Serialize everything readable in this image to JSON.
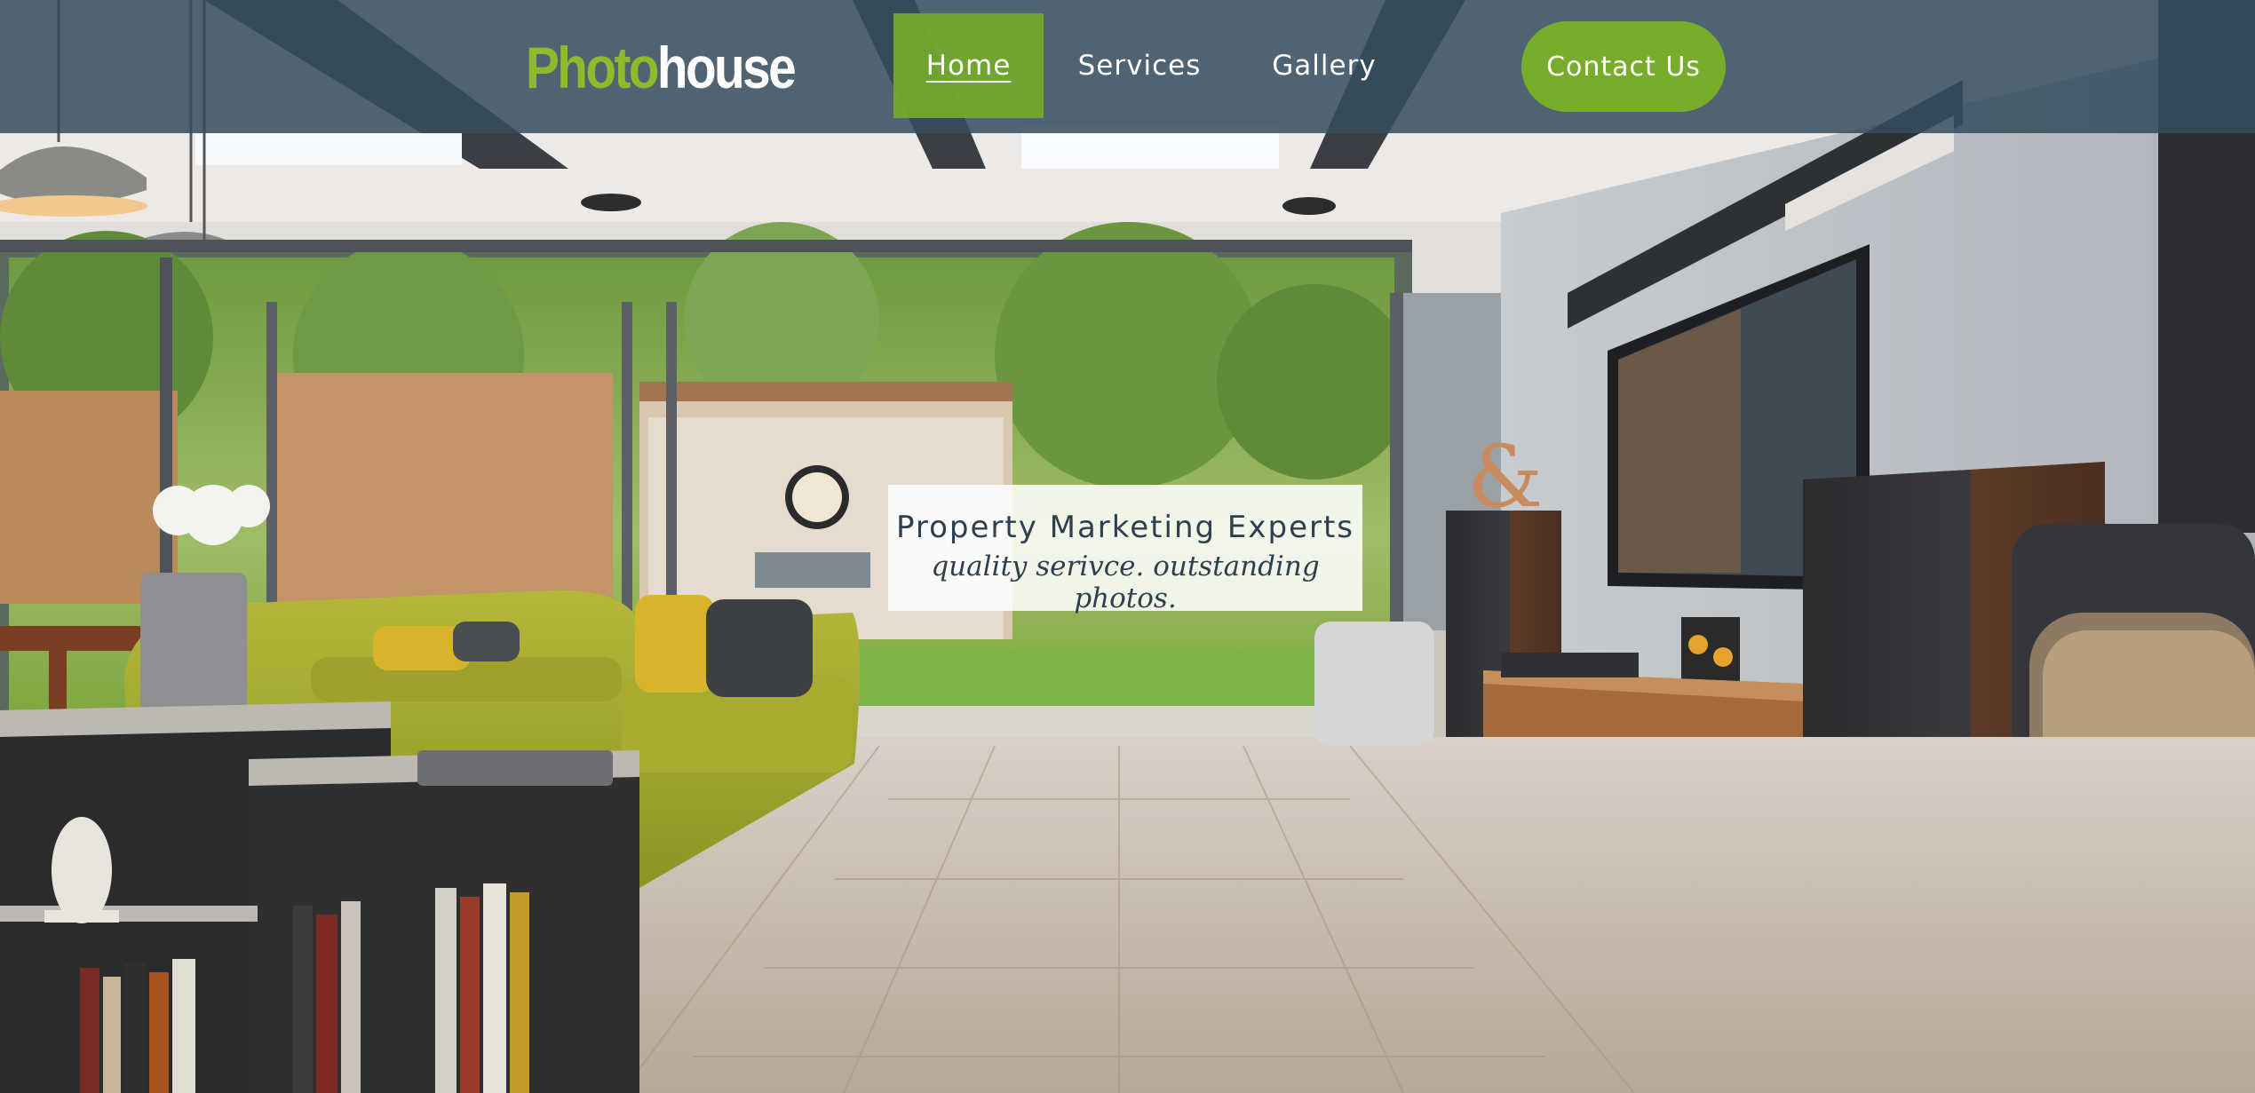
{
  "header": {
    "logo_part1": "Photo",
    "logo_part2": "house",
    "nav": [
      {
        "label": "Home",
        "active": true
      },
      {
        "label": "Services",
        "active": false
      },
      {
        "label": "Gallery",
        "active": false
      }
    ],
    "contact_label": "Contact Us"
  },
  "hero": {
    "headline": "Property Marketing Experts",
    "subline": "quality serivce. outstanding photos."
  },
  "colors": {
    "brand_green": "#77ad2a",
    "header_bg": "#344d5e",
    "text_dark": "#2e3f4f"
  }
}
